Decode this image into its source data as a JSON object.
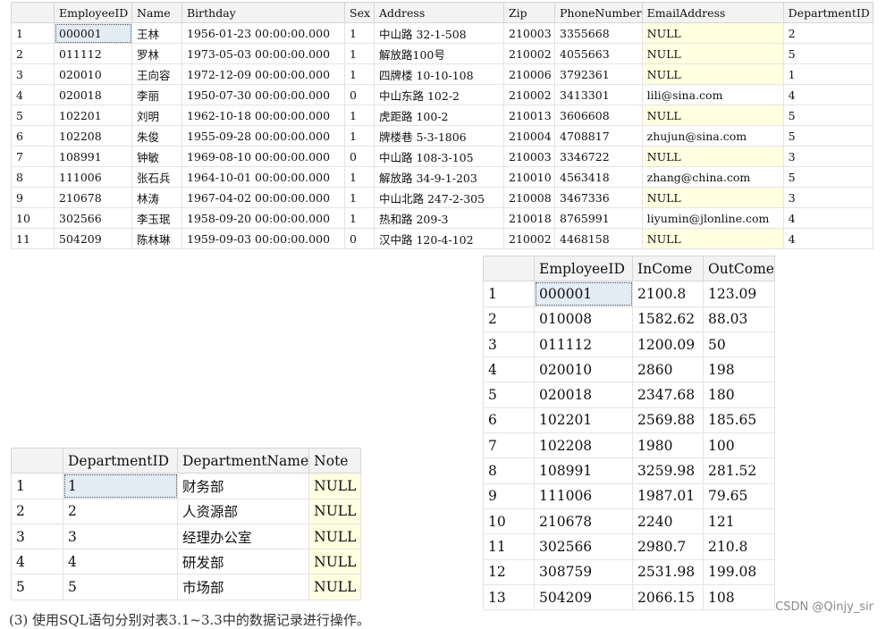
{
  "employees": {
    "columns": [
      "",
      "EmployeeID",
      "Name",
      "Birthday",
      "Sex",
      "Address",
      "Zip",
      "PhoneNumber",
      "EmailAddress",
      "DepartmentID"
    ],
    "rows": [
      [
        "1",
        "000001",
        "王林",
        "1956-01-23 00:00:00.000",
        "1",
        "中山路 32-1-508",
        "210003",
        "3355668",
        "NULL",
        "2"
      ],
      [
        "2",
        "011112",
        "罗林",
        "1973-05-03 00:00:00.000",
        "1",
        "解放路100号",
        "210002",
        "4055663",
        "NULL",
        "5"
      ],
      [
        "3",
        "020010",
        "王向容",
        "1972-12-09 00:00:00.000",
        "1",
        "四牌楼 10-10-108",
        "210006",
        "3792361",
        "NULL",
        "1"
      ],
      [
        "4",
        "020018",
        "李丽",
        "1950-07-30 00:00:00.000",
        "0",
        "中山东路 102-2",
        "210002",
        "3413301",
        "lili@sina.com",
        "4"
      ],
      [
        "5",
        "102201",
        "刘明",
        "1962-10-18 00:00:00.000",
        "1",
        "虎距路 100-2",
        "210013",
        "3606608",
        "NULL",
        "5"
      ],
      [
        "6",
        "102208",
        "朱俊",
        "1955-09-28 00:00:00.000",
        "1",
        "牌楼巷 5-3-1806",
        "210004",
        "4708817",
        "zhujun@sina.com",
        "5"
      ],
      [
        "7",
        "108991",
        "钟敏",
        "1969-08-10 00:00:00.000",
        "0",
        "中山路 108-3-105",
        "210003",
        "3346722",
        "NULL",
        "3"
      ],
      [
        "8",
        "111006",
        "张石兵",
        "1964-10-01 00:00:00.000",
        "1",
        "解放路 34-9-1-203",
        "210010",
        "4563418",
        "zhang@china.com",
        "5"
      ],
      [
        "9",
        "210678",
        "林涛",
        "1967-04-02 00:00:00.000",
        "1",
        "中山北路 247-2-305",
        "210008",
        "3467336",
        "NULL",
        "3"
      ],
      [
        "10",
        "302566",
        "李玉珉",
        "1958-09-20 00:00:00.000",
        "1",
        "热和路 209-3",
        "210018",
        "8765991",
        "liyumin@jlonline.com",
        "4"
      ],
      [
        "11",
        "504209",
        "陈林琳",
        "1959-09-03 00:00:00.000",
        "0",
        "汉中路 120-4-102",
        "210002",
        "4468158",
        "NULL",
        "4"
      ]
    ]
  },
  "salary": {
    "columns": [
      "",
      "EmployeeID",
      "InCome",
      "OutCome"
    ],
    "rows": [
      [
        "1",
        "000001",
        "2100.8",
        "123.09"
      ],
      [
        "2",
        "010008",
        "1582.62",
        "88.03"
      ],
      [
        "3",
        "011112",
        "1200.09",
        "50"
      ],
      [
        "4",
        "020010",
        "2860",
        "198"
      ],
      [
        "5",
        "020018",
        "2347.68",
        "180"
      ],
      [
        "6",
        "102201",
        "2569.88",
        "185.65"
      ],
      [
        "7",
        "102208",
        "1980",
        "100"
      ],
      [
        "8",
        "108991",
        "3259.98",
        "281.52"
      ],
      [
        "9",
        "111006",
        "1987.01",
        "79.65"
      ],
      [
        "10",
        "210678",
        "2240",
        "121"
      ],
      [
        "11",
        "302566",
        "2980.7",
        "210.8"
      ],
      [
        "12",
        "308759",
        "2531.98",
        "199.08"
      ],
      [
        "13",
        "504209",
        "2066.15",
        "108"
      ]
    ]
  },
  "departments": {
    "columns": [
      "",
      "DepartmentID",
      "DepartmentName",
      "Note"
    ],
    "rows": [
      [
        "1",
        "1",
        "财务部",
        "NULL"
      ],
      [
        "2",
        "2",
        "人资源部",
        "NULL"
      ],
      [
        "3",
        "3",
        "经理办公室",
        "NULL"
      ],
      [
        "4",
        "4",
        "研发部",
        "NULL"
      ],
      [
        "5",
        "5",
        "市场部",
        "NULL"
      ]
    ]
  },
  "caption": "(3) 使用SQL语句分别对表3.1~3.3中的数据记录进行操作。",
  "watermark": "CSDN @Qinjy_sir"
}
